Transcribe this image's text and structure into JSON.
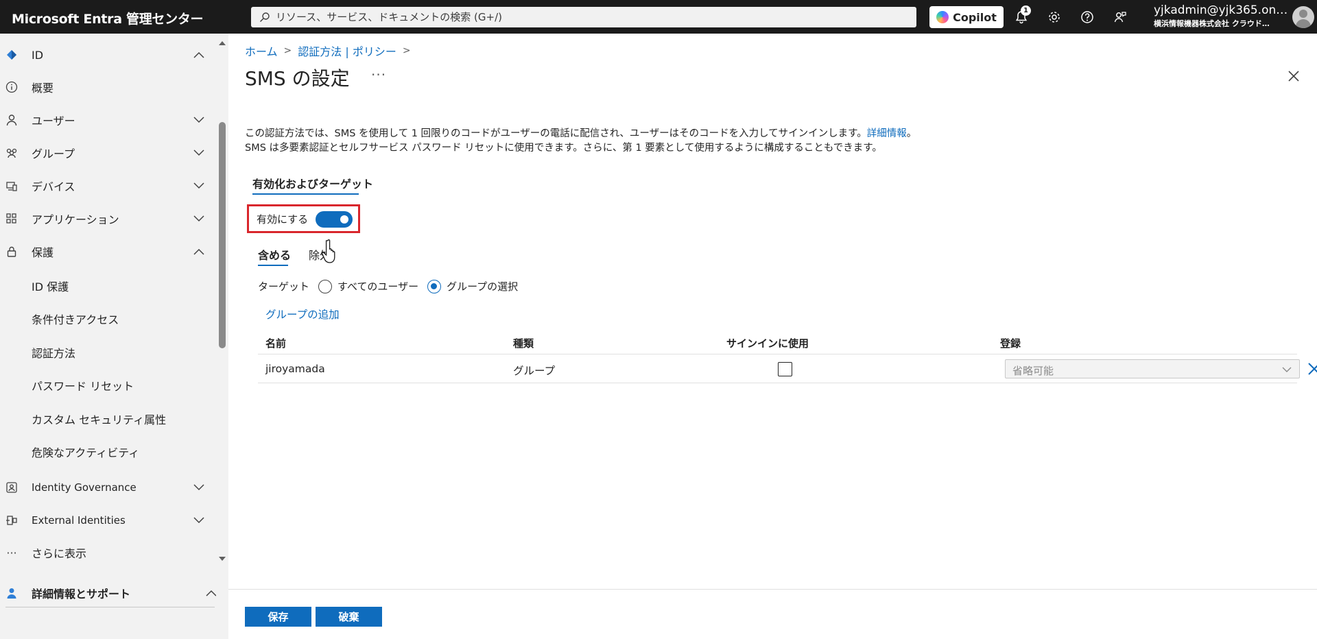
{
  "app": {
    "title": "Microsoft Entra 管理センター"
  },
  "topbar": {
    "search_placeholder": "リソース、サービス、ドキュメントの検索 (G+/)",
    "copilot_label": "Copilot",
    "notification_count": "1",
    "account_email": "yjkadmin@yjk365.on…",
    "account_org": "横浜情報機器株式会社 クラウド…"
  },
  "sidebar": {
    "items": [
      {
        "label": "ID",
        "icon": "diamond-icon"
      },
      {
        "label": "概要",
        "icon": "info-icon"
      },
      {
        "label": "ユーザー",
        "icon": "person-icon"
      },
      {
        "label": "グループ",
        "icon": "people-icon"
      },
      {
        "label": "デバイス",
        "icon": "device-icon"
      },
      {
        "label": "アプリケーション",
        "icon": "apps-icon"
      },
      {
        "label": "保護",
        "icon": "lock-icon"
      },
      {
        "label": "ID 保護"
      },
      {
        "label": "条件付きアクセス"
      },
      {
        "label": "認証方法"
      },
      {
        "label": "パスワード リセット"
      },
      {
        "label": "カスタム セキュリティ属性"
      },
      {
        "label": "危険なアクティビティ"
      },
      {
        "label": "Identity Governance",
        "icon": "governance-icon"
      },
      {
        "label": "External Identities",
        "icon": "external-icon"
      },
      {
        "label": "さらに表示",
        "icon": "ellipsis-icon"
      }
    ],
    "support_label": "詳細情報とサポート",
    "collapse_label": "«"
  },
  "breadcrumb": {
    "home": "ホーム",
    "auth": "認証方法 | ポリシー"
  },
  "page": {
    "title": "SMS の設定",
    "more": "···",
    "description_line1": "この認証方法では、SMS を使用して 1 回限りのコードがユーザーの電話に配信され、ユーザーはそのコードを入力してサインインします。",
    "description_link": "詳細情報",
    "description_line1_end": "。",
    "description_line2": "SMS は多要素認証とセルフサービス パスワード リセットに使用できます。さらに、第 1 要素として使用するように構成することもできます。",
    "section_tab": "有効化およびターゲット",
    "enable_label": "有効にする",
    "include_tab": "含める",
    "exclude_tab": "除外",
    "target_label": "ターゲット",
    "all_users_label": "すべてのユーザー",
    "select_groups_label": "グループの選択",
    "add_group_label": "グループの追加"
  },
  "table": {
    "headers": [
      "名前",
      "種類",
      "サインインに使用",
      "登録"
    ],
    "rows": [
      {
        "name": "jiroyamada",
        "type": "グループ",
        "signin": false,
        "registration": "省略可能"
      }
    ]
  },
  "footer": {
    "save_label": "保存",
    "discard_label": "破棄"
  },
  "colors": {
    "accent": "#0f6cbd",
    "highlight": "#d9262c",
    "topbar": "#1b1b1b"
  }
}
